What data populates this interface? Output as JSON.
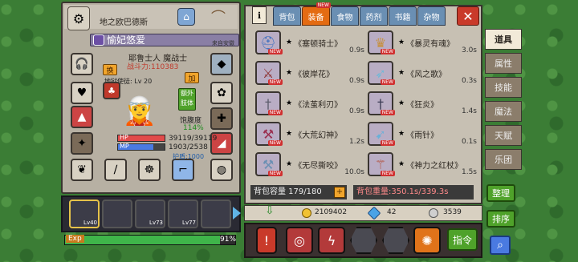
{
  "character": {
    "realm_name": "地之欧巴德斯",
    "char_name": "愉妃悠爱",
    "recently_text": "来自安徽",
    "class_label": "耶鲁士人  魔战士",
    "power_label": "战斗力:",
    "power_value": "110383",
    "level_label": "Lv 20",
    "mentor_label": "地狱使徒:",
    "swap_label": "换",
    "add_label": "加",
    "extra_body_label": "额外肢体",
    "satiety_label": "饱腹度",
    "satiety_value": "114%",
    "hp_label": "HP",
    "hp_value": "39119/39119",
    "hp_fraction": 1.0,
    "mp_label": "MP",
    "mp_value": "1903/2538",
    "mp_fraction": 0.75,
    "shield_label": "护盾:1000"
  },
  "bottom": {
    "slot_levels": [
      "Lv40",
      "",
      "Lv73",
      "Lv77",
      ""
    ],
    "exp_label": "Exp",
    "exp_percent": "91%",
    "exp_fraction": 0.91
  },
  "inventory": {
    "tabs": [
      "背包",
      "装备",
      "食物",
      "药剂",
      "书籍",
      "杂物"
    ],
    "active_tab": 1,
    "new_label": "NEW",
    "items": [
      {
        "name": "《塞顿骑士》",
        "time": "0.9s",
        "icon": "helmet-icon",
        "new": true
      },
      {
        "name": "《暴灵有魂》",
        "time": "3.0s",
        "icon": "crown-icon",
        "new": true
      },
      {
        "name": "《彼岸花》",
        "time": "0.9s",
        "icon": "sword-icon",
        "new": true
      },
      {
        "name": "《风之歌》",
        "time": "0.3s",
        "icon": "blade-icon",
        "new": true
      },
      {
        "name": "《法茧利刃》",
        "time": "0.9s",
        "icon": "dagger-icon",
        "new": true
      },
      {
        "name": "《狂炎》",
        "time": "1.4s",
        "icon": "dagger-icon",
        "new": true
      },
      {
        "name": "《大荒幻神》",
        "time": "1.2s",
        "icon": "axe-icon",
        "new": true
      },
      {
        "name": "《雨针》",
        "time": "0.1s",
        "icon": "needle-icon",
        "new": true
      },
      {
        "name": "《无尽撕咬》",
        "time": "10.0s",
        "icon": "double-axe-icon",
        "new": true
      },
      {
        "name": "《神力之红杖》",
        "time": "1.5s",
        "icon": "staff-icon",
        "new": true
      }
    ],
    "capacity": "背包容量 179/180",
    "weight": "背包重量:350.1s/339.3s",
    "gold": "2109402",
    "gems": "42",
    "silver": "3539"
  },
  "side_menu": [
    "道具",
    "属性",
    "技能",
    "魔法",
    "天赋",
    "乐团"
  ],
  "side_active": 0,
  "buttons": {
    "organize": "整理",
    "sort": "排序",
    "command": "指令"
  }
}
